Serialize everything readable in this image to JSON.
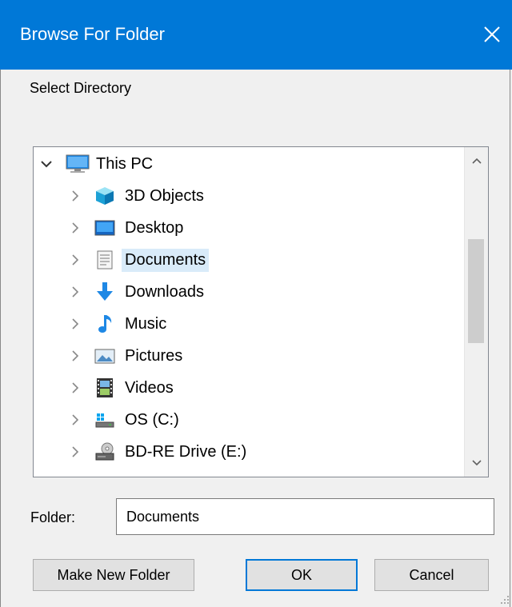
{
  "window": {
    "title": "Browse For Folder",
    "close_glyph": "✕"
  },
  "prompt": "Select Directory",
  "tree": {
    "root": {
      "label": "This PC",
      "icon": "computer-icon",
      "expanded": true
    },
    "items": [
      {
        "label": "3D Objects",
        "icon": "3d-objects-icon",
        "selected": false
      },
      {
        "label": "Desktop",
        "icon": "desktop-icon",
        "selected": false
      },
      {
        "label": "Documents",
        "icon": "documents-icon",
        "selected": true
      },
      {
        "label": "Downloads",
        "icon": "downloads-icon",
        "selected": false
      },
      {
        "label": "Music",
        "icon": "music-icon",
        "selected": false
      },
      {
        "label": "Pictures",
        "icon": "pictures-icon",
        "selected": false
      },
      {
        "label": "Videos",
        "icon": "videos-icon",
        "selected": false
      },
      {
        "label": "OS (C:)",
        "icon": "drive-icon",
        "selected": false
      },
      {
        "label": "BD-RE Drive (E:)",
        "icon": "optical-drive-icon",
        "selected": false
      }
    ]
  },
  "folder": {
    "label": "Folder:",
    "value": "Documents"
  },
  "buttons": {
    "make_new_folder": "Make New Folder",
    "ok": "OK",
    "cancel": "Cancel"
  },
  "colors": {
    "titlebar": "#0078d7",
    "selection": "#d9ebf9",
    "background": "#f0f0f0"
  }
}
